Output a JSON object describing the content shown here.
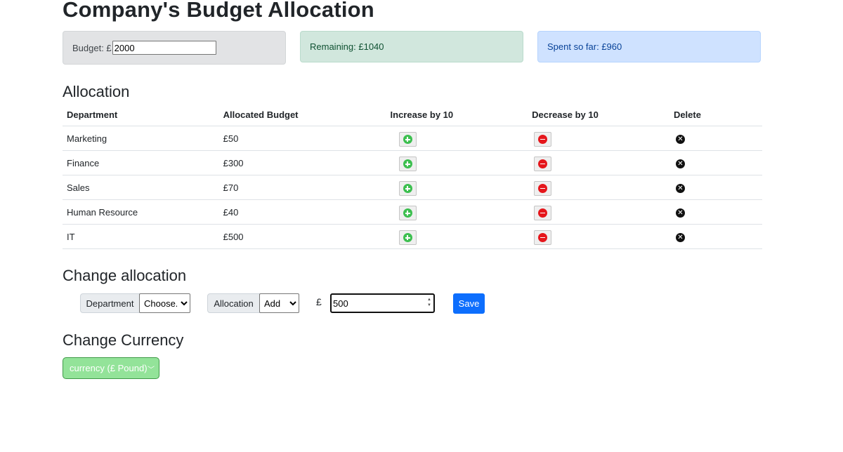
{
  "page": {
    "title": "Company's Budget Allocation"
  },
  "summary": {
    "budget_label": "Budget: £",
    "budget_value": "2000",
    "remaining_label": "Remaining: £1040",
    "spent_label": "Spent so far: £960"
  },
  "allocation": {
    "title": "Allocation",
    "columns": [
      "Department",
      "Allocated Budget",
      "Increase by 10",
      "Decrease by 10",
      "Delete"
    ],
    "rows": [
      {
        "department": "Marketing",
        "budget": "£50"
      },
      {
        "department": "Finance",
        "budget": "£300"
      },
      {
        "department": "Sales",
        "budget": "£70"
      },
      {
        "department": "Human Resource",
        "budget": "£40"
      },
      {
        "department": "IT",
        "budget": "£500"
      }
    ],
    "icons": {
      "increase": "plus-circle-icon",
      "decrease": "minus-circle-icon",
      "delete": "x-circle-icon"
    }
  },
  "change_allocation": {
    "title": "Change allocation",
    "department_label": "Department",
    "department_selected": "Choose...",
    "allocation_label": "Allocation",
    "allocation_selected": "Add",
    "currency_symbol": "£",
    "amount_value": "500",
    "save_label": "Save"
  },
  "currency": {
    "title": "Change Currency",
    "selected": "currency (£ Pound)"
  },
  "colors": {
    "primary": "#0d6efd",
    "increase": "#3cbf4f",
    "decrease": "#e5161b",
    "currency_bg": "#93e399"
  }
}
